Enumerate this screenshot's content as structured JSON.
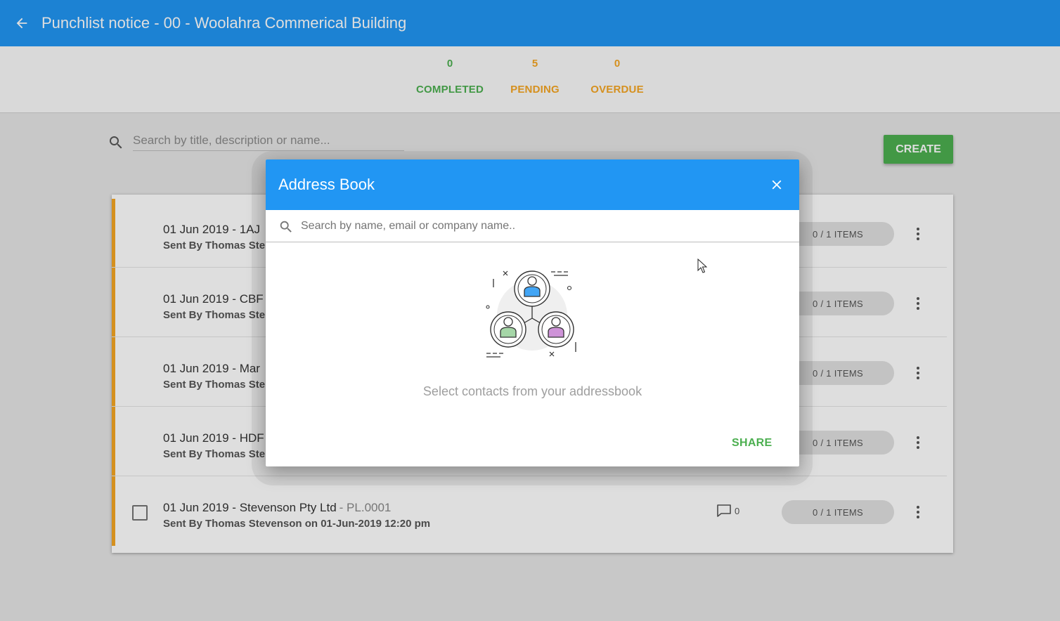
{
  "appbar": {
    "title": "Punchlist notice - 00 - Woolahra Commerical Building"
  },
  "stats": [
    {
      "value": "0",
      "label": "COMPLETED",
      "color": "#4caf50"
    },
    {
      "value": "5",
      "label": "PENDING",
      "color": "#f5a623"
    },
    {
      "value": "0",
      "label": "OVERDUE",
      "color": "#f5a623"
    }
  ],
  "search": {
    "placeholder": "Search by title, description or name..."
  },
  "create_label": "CREATE",
  "rows": [
    {
      "title": "01 Jun 2019 - 1AJ",
      "code": "",
      "sent_by": "Sent By Thomas Ste",
      "comments": "",
      "items": "0 / 1 ITEMS"
    },
    {
      "title": "01 Jun 2019 - CBF",
      "code": "",
      "sent_by": "Sent By Thomas Ste",
      "comments": "",
      "items": "0 / 1 ITEMS"
    },
    {
      "title": "01 Jun 2019 - Mar",
      "code": "",
      "sent_by": "Sent By Thomas Ste",
      "comments": "",
      "items": "0 / 1 ITEMS"
    },
    {
      "title": "01 Jun 2019 - HDF",
      "code": "",
      "sent_by": "Sent By Thomas Ste",
      "comments": "",
      "items": "0 / 1 ITEMS"
    },
    {
      "title": "01 Jun 2019 - Stevenson Pty Ltd",
      "code": "- PL.0001",
      "sent_by": "Sent By Thomas Stevenson on 01-Jun-2019 12:20 pm",
      "comments": "0",
      "items": "0 / 1 ITEMS"
    }
  ],
  "dialog": {
    "title": "Address Book",
    "search_placeholder": "Search by name, email or company name..",
    "empty_text": "Select contacts from your addressbook",
    "share_label": "SHARE"
  },
  "colors": {
    "primary": "#2196f3",
    "success": "#4caf50",
    "warning": "#f5a623"
  },
  "icons": [
    "arrow-back-icon",
    "search-icon",
    "close-icon",
    "comment-icon",
    "more-vert-icon",
    "contacts-illustration",
    "mouse-cursor-icon"
  ]
}
